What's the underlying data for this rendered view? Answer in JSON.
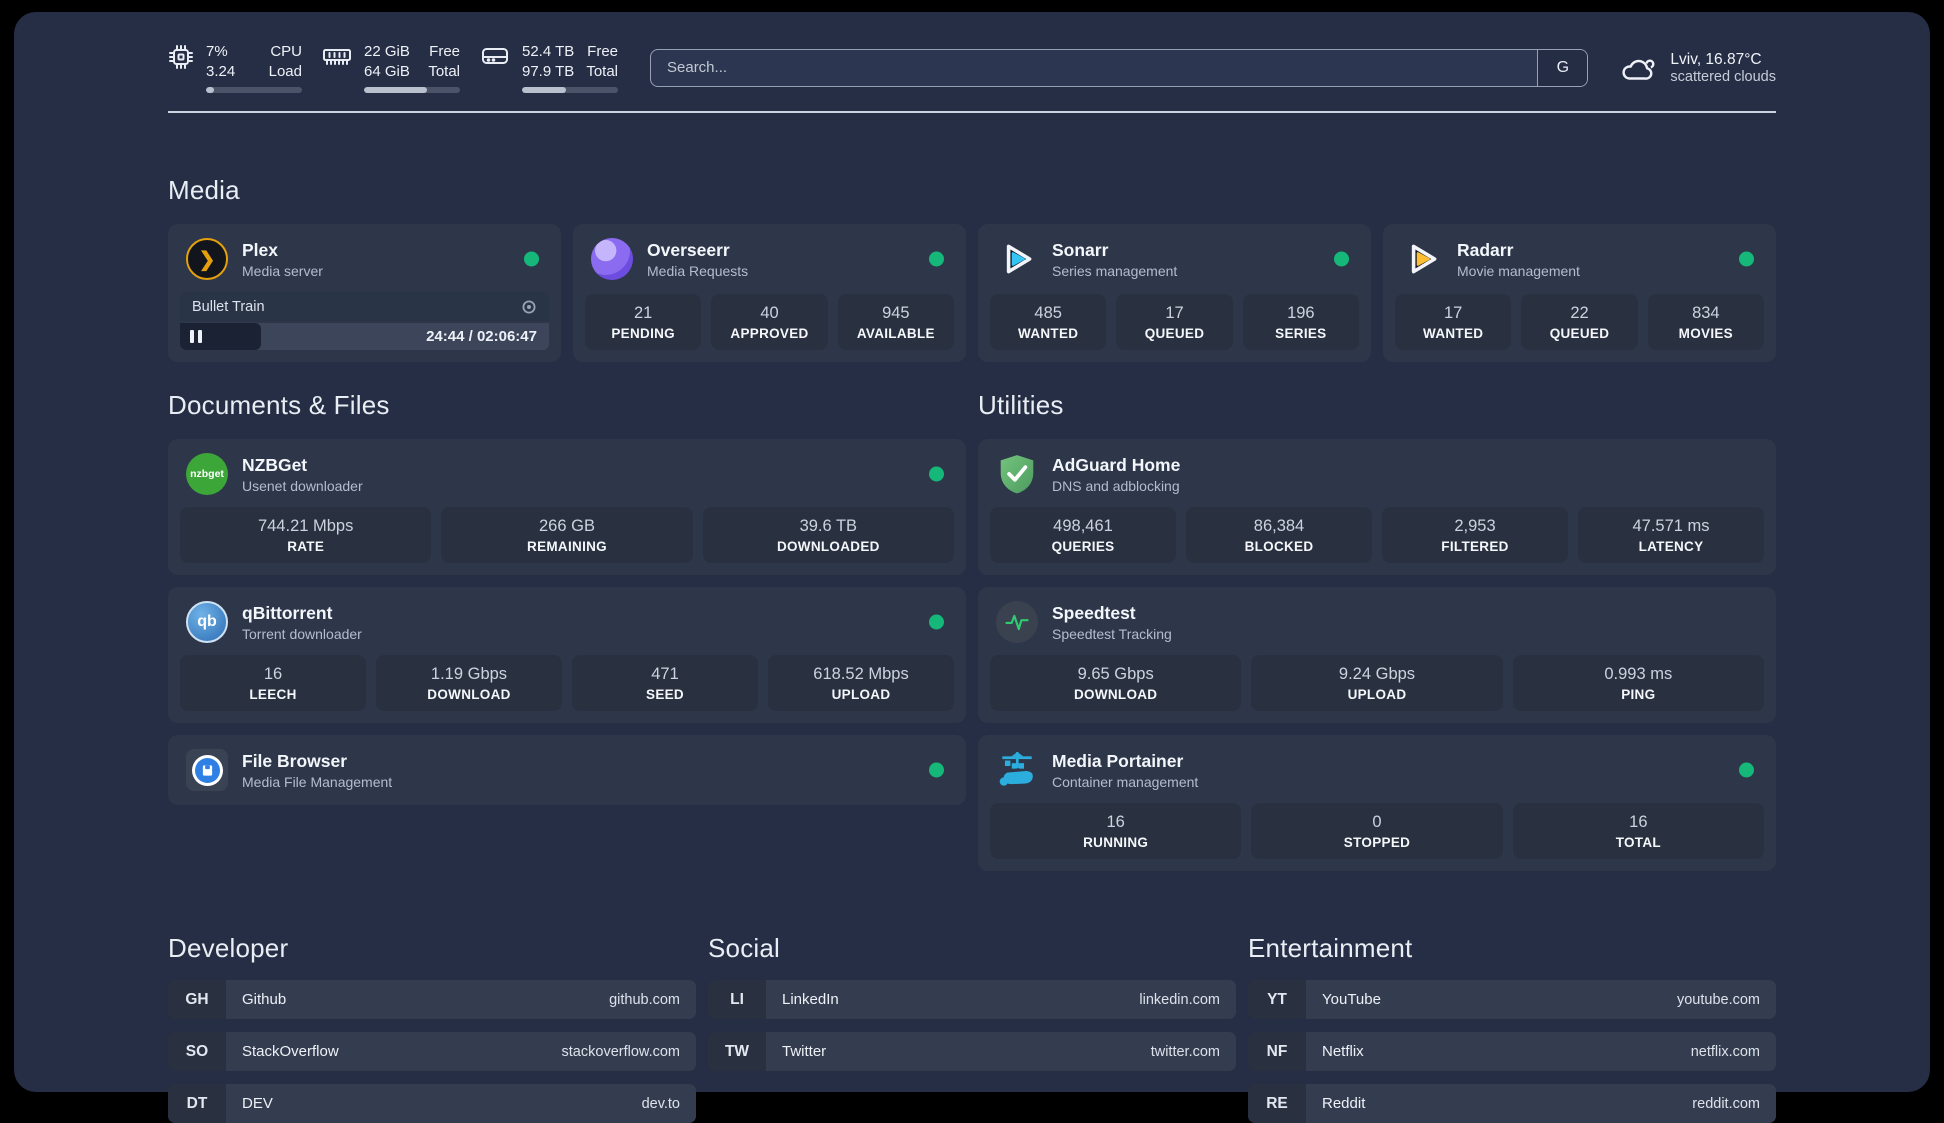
{
  "colors": {
    "accent_green": "#15b879",
    "panel_bg": "#252e44",
    "card_bg": "#2e3749"
  },
  "header": {
    "hardware": [
      {
        "id": "cpu",
        "value1": "7%",
        "value2": "3.24",
        "label1": "CPU",
        "label2": "Load",
        "progress_pct": 8
      },
      {
        "id": "memory",
        "value1": "22 GiB",
        "value2": "64 GiB",
        "label1": "Free",
        "label2": "Total",
        "progress_pct": 66
      },
      {
        "id": "storage",
        "value1": "52.4 TB",
        "value2": "97.9 TB",
        "label1": "Free",
        "label2": "Total",
        "progress_pct": 46
      }
    ],
    "search": {
      "placeholder": "Search...",
      "engine_button": "G"
    },
    "weather": {
      "location_temp": "Lviv, 16.87°C",
      "condition": "scattered clouds"
    }
  },
  "media": {
    "heading": "Media",
    "cards": [
      {
        "name": "Plex",
        "description": "Media server",
        "online": true,
        "player": {
          "title": "Bullet Train",
          "time_display": "24:44 / 02:06:47",
          "progress_pct": 22
        }
      },
      {
        "name": "Overseerr",
        "description": "Media Requests",
        "online": true,
        "stats": [
          {
            "value": "21",
            "label": "PENDING"
          },
          {
            "value": "40",
            "label": "APPROVED"
          },
          {
            "value": "945",
            "label": "AVAILABLE"
          }
        ]
      },
      {
        "name": "Sonarr",
        "description": "Series management",
        "online": true,
        "stats": [
          {
            "value": "485",
            "label": "WANTED"
          },
          {
            "value": "17",
            "label": "QUEUED"
          },
          {
            "value": "196",
            "label": "SERIES"
          }
        ]
      },
      {
        "name": "Radarr",
        "description": "Movie management",
        "online": true,
        "stats": [
          {
            "value": "17",
            "label": "WANTED"
          },
          {
            "value": "22",
            "label": "QUEUED"
          },
          {
            "value": "834",
            "label": "MOVIES"
          }
        ]
      }
    ]
  },
  "documents": {
    "heading": "Documents & Files",
    "cards": [
      {
        "name": "NZBGet",
        "description": "Usenet downloader",
        "online": true,
        "icon_text": "nzbget",
        "stats": [
          {
            "value": "744.21 Mbps",
            "label": "RATE"
          },
          {
            "value": "266 GB",
            "label": "REMAINING"
          },
          {
            "value": "39.6 TB",
            "label": "DOWNLOADED"
          }
        ]
      },
      {
        "name": "qBittorrent",
        "description": "Torrent downloader",
        "online": true,
        "icon_text": "qb",
        "stats": [
          {
            "value": "16",
            "label": "LEECH"
          },
          {
            "value": "1.19 Gbps",
            "label": "DOWNLOAD"
          },
          {
            "value": "471",
            "label": "SEED"
          },
          {
            "value": "618.52 Mbps",
            "label": "UPLOAD"
          }
        ]
      },
      {
        "name": "File Browser",
        "description": "Media File Management",
        "online": true
      }
    ]
  },
  "utilities": {
    "heading": "Utilities",
    "cards": [
      {
        "name": "AdGuard Home",
        "description": "DNS and adblocking",
        "online": false,
        "stats": [
          {
            "value": "498,461",
            "label": "QUERIES"
          },
          {
            "value": "86,384",
            "label": "BLOCKED"
          },
          {
            "value": "2,953",
            "label": "FILTERED"
          },
          {
            "value": "47.571 ms",
            "label": "LATENCY"
          }
        ]
      },
      {
        "name": "Speedtest",
        "description": "Speedtest Tracking",
        "online": false,
        "stats": [
          {
            "value": "9.65 Gbps",
            "label": "DOWNLOAD"
          },
          {
            "value": "9.24 Gbps",
            "label": "UPLOAD"
          },
          {
            "value": "0.993 ms",
            "label": "PING"
          }
        ]
      },
      {
        "name": "Media Portainer",
        "description": "Container management",
        "online": true,
        "stats": [
          {
            "value": "16",
            "label": "RUNNING"
          },
          {
            "value": "0",
            "label": "STOPPED"
          },
          {
            "value": "16",
            "label": "TOTAL"
          }
        ]
      }
    ]
  },
  "links": {
    "developer": {
      "heading": "Developer",
      "items": [
        {
          "abbr": "GH",
          "name": "Github",
          "url": "github.com"
        },
        {
          "abbr": "SO",
          "name": "StackOverflow",
          "url": "stackoverflow.com"
        },
        {
          "abbr": "DT",
          "name": "DEV",
          "url": "dev.to"
        }
      ]
    },
    "social": {
      "heading": "Social",
      "items": [
        {
          "abbr": "LI",
          "name": "LinkedIn",
          "url": "linkedin.com"
        },
        {
          "abbr": "TW",
          "name": "Twitter",
          "url": "twitter.com"
        }
      ]
    },
    "entertainment": {
      "heading": "Entertainment",
      "items": [
        {
          "abbr": "YT",
          "name": "YouTube",
          "url": "youtube.com"
        },
        {
          "abbr": "NF",
          "name": "Netflix",
          "url": "netflix.com"
        },
        {
          "abbr": "RE",
          "name": "Reddit",
          "url": "reddit.com"
        }
      ]
    }
  }
}
